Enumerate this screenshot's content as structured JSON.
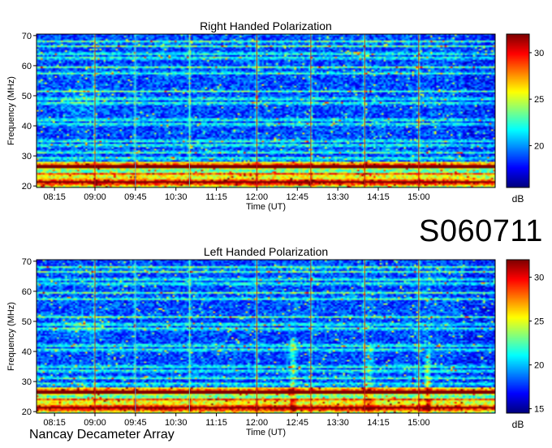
{
  "observation_id": "S060711",
  "instrument": "Nancay Decameter Array",
  "chart_data": [
    {
      "type": "heatmap",
      "title": "Right Handed Polarization",
      "xlabel": "Time (UT)",
      "ylabel": "Frequency (MHz)",
      "x_ticks": [
        "08:15",
        "09:00",
        "09:45",
        "10:30",
        "11:15",
        "12:00",
        "12:45",
        "13:30",
        "14:15",
        "15:00"
      ],
      "x_range": [
        "07:55",
        "16:25"
      ],
      "y_ticks": [
        20,
        30,
        40,
        50,
        60,
        70
      ],
      "ylim": [
        19.5,
        70.5
      ],
      "colorbar": {
        "label": "dB",
        "ticks": [
          20,
          25,
          30
        ],
        "range": [
          15.5,
          32
        ]
      },
      "strong_bands_mhz": [
        21.5,
        24,
        26.5,
        27.8,
        29.2,
        31.2,
        33.5,
        35,
        40.5,
        42,
        47.5,
        49,
        51.5,
        57.5,
        59.5,
        62.5,
        64,
        66.5,
        68
      ],
      "vertical_markers_ut": [
        "09:00",
        "09:45",
        "10:45",
        "12:00",
        "13:00",
        "14:00",
        "15:00"
      ]
    },
    {
      "type": "heatmap",
      "title": "Left Handed Polarization",
      "xlabel": "Time (UT)",
      "ylabel": "Frequency (MHz)",
      "x_ticks": [
        "08:15",
        "09:00",
        "09:45",
        "10:30",
        "11:15",
        "12:00",
        "12:45",
        "13:30",
        "14:15",
        "15:00"
      ],
      "x_range": [
        "07:55",
        "16:25"
      ],
      "y_ticks": [
        20,
        30,
        40,
        50,
        60,
        70
      ],
      "ylim": [
        19.5,
        70.5
      ],
      "colorbar": {
        "label": "dB",
        "ticks": [
          15,
          20,
          25,
          30
        ],
        "range": [
          14.5,
          32
        ]
      },
      "strong_bands_mhz": [
        21.5,
        24,
        26.5,
        27.8,
        29.2,
        31.2,
        33.5,
        35,
        40.5,
        42,
        47.5,
        49,
        51.5,
        57.5,
        59.5,
        62.5,
        64,
        66.5,
        68
      ],
      "vertical_markers_ut": [
        "09:00",
        "09:45",
        "10:45",
        "12:00",
        "13:00",
        "14:00",
        "15:00"
      ]
    }
  ]
}
